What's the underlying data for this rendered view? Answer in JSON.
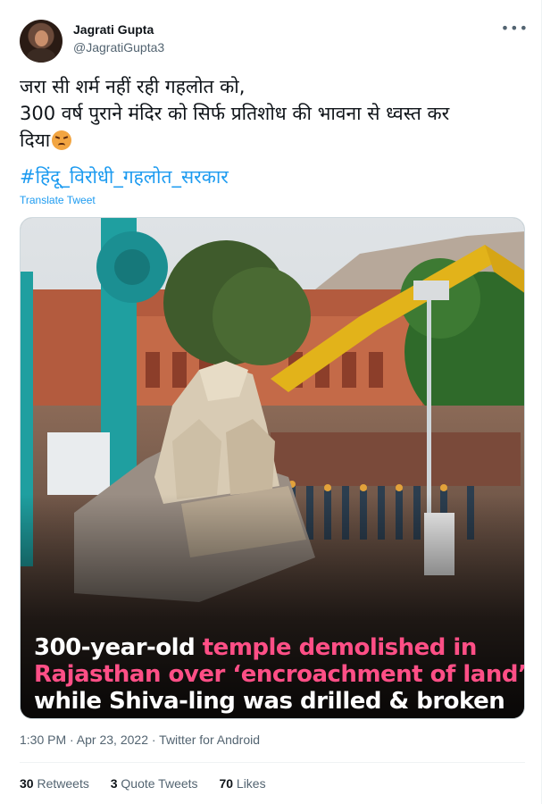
{
  "tweet": {
    "author": {
      "name": "Jagrati Gupta",
      "handle": "@JagratiGupta3"
    },
    "more_icon": "more-horizontal-icon",
    "text_lines": [
      "जरा सी शर्म नहीं रही गहलोत को,",
      "300 वर्ष पुराने मंदिर को सिर्फ प्रतिशोध की भावना से ध्वस्त कर",
      "दिया"
    ],
    "emoji": "angry-face-emoji",
    "hashtag": "#हिंदू_विरोधी_गहलोत_सरकार",
    "translate_label": "Translate Tweet",
    "media": {
      "caption_parts": [
        {
          "text": "300-year-old ",
          "highlight": false
        },
        {
          "text": "temple demolished in",
          "highlight": true
        },
        {
          "text": "Rajasthan over ‘encroachment of land’",
          "highlight": true
        },
        {
          "text": "while Shiva-ling was drilled & broken",
          "highlight": false
        }
      ]
    },
    "timestamp": "1:30 PM · Apr 23, 2022 · ",
    "source": "Twitter for Android",
    "stats": {
      "retweets_count": "30",
      "retweets_label": "Retweets",
      "quotes_count": "3",
      "quotes_label": "Quote Tweets",
      "likes_count": "70",
      "likes_label": "Likes"
    },
    "colors": {
      "link": "#1d9bf0",
      "caption_highlight": "#ff4f86",
      "secondary_text": "#536471"
    }
  }
}
